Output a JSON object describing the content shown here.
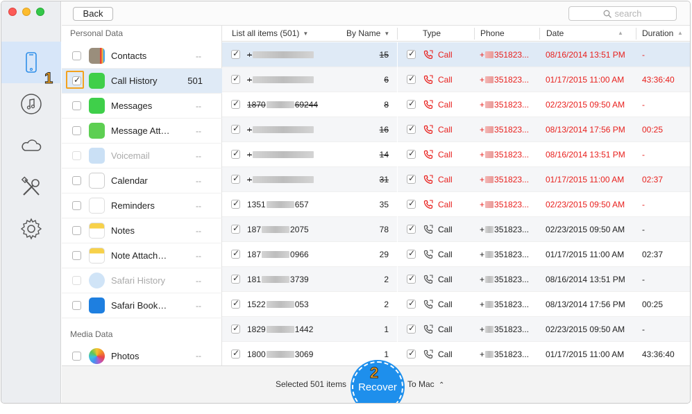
{
  "toolbar": {
    "back_label": "Back",
    "search_placeholder": "search"
  },
  "sidebar": {
    "icons": [
      "phone-icon",
      "music-icon",
      "cloud-icon",
      "tools-icon",
      "gear-icon"
    ]
  },
  "categories": {
    "personal_title": "Personal Data",
    "media_title": "Media Data",
    "items": [
      {
        "label": "Contacts",
        "count": "--",
        "checked": false,
        "disabled": false,
        "icon": "contacts-icon"
      },
      {
        "label": "Call History",
        "count": "501",
        "checked": true,
        "disabled": false,
        "icon": "phone-app-icon"
      },
      {
        "label": "Messages",
        "count": "--",
        "checked": false,
        "disabled": false,
        "icon": "messages-icon"
      },
      {
        "label": "Message Att…",
        "count": "--",
        "checked": false,
        "disabled": false,
        "icon": "message-attachment-icon"
      },
      {
        "label": "Voicemail",
        "count": "--",
        "checked": false,
        "disabled": true,
        "icon": "voicemail-icon"
      },
      {
        "label": "Calendar",
        "count": "--",
        "checked": false,
        "disabled": false,
        "icon": "calendar-icon"
      },
      {
        "label": "Reminders",
        "count": "--",
        "checked": false,
        "disabled": false,
        "icon": "reminders-icon"
      },
      {
        "label": "Notes",
        "count": "--",
        "checked": false,
        "disabled": false,
        "icon": "notes-icon"
      },
      {
        "label": "Note Attach…",
        "count": "--",
        "checked": false,
        "disabled": false,
        "icon": "note-attachment-icon"
      },
      {
        "label": "Safari History",
        "count": "--",
        "checked": false,
        "disabled": true,
        "icon": "safari-icon"
      },
      {
        "label": "Safari Book…",
        "count": "--",
        "checked": false,
        "disabled": false,
        "icon": "bookmark-icon"
      }
    ],
    "media_items": [
      {
        "label": "Photos",
        "count": "--",
        "checked": false,
        "disabled": false,
        "icon": "photos-icon"
      }
    ]
  },
  "list_header": {
    "filter_label": "List all items (501)",
    "sort_label": "By Name"
  },
  "detail_header": {
    "type": "Type",
    "phone": "Phone",
    "date": "Date",
    "duration": "Duration"
  },
  "names": [
    {
      "prefix": "+",
      "suffix": "",
      "count": "15",
      "deleted": true
    },
    {
      "prefix": "+",
      "suffix": "",
      "count": "6",
      "deleted": true
    },
    {
      "prefix": "1870",
      "suffix": "69244",
      "count": "8",
      "deleted": true
    },
    {
      "prefix": "+",
      "suffix": "",
      "count": "16",
      "deleted": true
    },
    {
      "prefix": "+",
      "suffix": "",
      "count": "14",
      "deleted": true
    },
    {
      "prefix": "+",
      "suffix": "",
      "count": "31",
      "deleted": true
    },
    {
      "prefix": "1351",
      "suffix": "657",
      "count": "35",
      "deleted": false
    },
    {
      "prefix": "187",
      "suffix": "2075",
      "count": "78",
      "deleted": false
    },
    {
      "prefix": "187",
      "suffix": "0966",
      "count": "29",
      "deleted": false
    },
    {
      "prefix": "181",
      "suffix": "3739",
      "count": "2",
      "deleted": false
    },
    {
      "prefix": "1522",
      "suffix": "053",
      "count": "2",
      "deleted": false
    },
    {
      "prefix": "1829",
      "suffix": "1442",
      "count": "1",
      "deleted": false
    },
    {
      "prefix": "1800",
      "suffix": "3069",
      "count": "1",
      "deleted": false
    }
  ],
  "calls": [
    {
      "type": "Call",
      "phone_prefix": "+",
      "phone_suffix": "351823...",
      "date": "08/16/2014 13:51 PM",
      "duration": "-",
      "deleted": true
    },
    {
      "type": "Call",
      "phone_prefix": "+",
      "phone_suffix": "351823...",
      "date": "01/17/2015 11:00 AM",
      "duration": "43:36:40",
      "deleted": true
    },
    {
      "type": "Call",
      "phone_prefix": "+",
      "phone_suffix": "351823...",
      "date": "02/23/2015 09:50 AM",
      "duration": "-",
      "deleted": true
    },
    {
      "type": "Call",
      "phone_prefix": "+",
      "phone_suffix": "351823...",
      "date": "08/13/2014 17:56 PM",
      "duration": "00:25",
      "deleted": true
    },
    {
      "type": "Call",
      "phone_prefix": "+",
      "phone_suffix": "351823...",
      "date": "08/16/2014 13:51 PM",
      "duration": "-",
      "deleted": true
    },
    {
      "type": "Call",
      "phone_prefix": "+",
      "phone_suffix": "351823...",
      "date": "01/17/2015 11:00 AM",
      "duration": "02:37",
      "deleted": true
    },
    {
      "type": "Call",
      "phone_prefix": "+",
      "phone_suffix": "351823...",
      "date": "02/23/2015 09:50 AM",
      "duration": "-",
      "deleted": true
    },
    {
      "type": "Call",
      "phone_prefix": "+",
      "phone_suffix": "351823...",
      "date": "02/23/2015 09:50 AM",
      "duration": "-",
      "deleted": false
    },
    {
      "type": "Call",
      "phone_prefix": "+",
      "phone_suffix": "351823...",
      "date": "01/17/2015 11:00 AM",
      "duration": "02:37",
      "deleted": false
    },
    {
      "type": "Call",
      "phone_prefix": "+",
      "phone_suffix": "351823...",
      "date": "08/16/2014 13:51 PM",
      "duration": "-",
      "deleted": false
    },
    {
      "type": "Call",
      "phone_prefix": "+",
      "phone_suffix": "351823...",
      "date": "08/13/2014 17:56 PM",
      "duration": "00:25",
      "deleted": false
    },
    {
      "type": "Call",
      "phone_prefix": "+",
      "phone_suffix": "351823...",
      "date": "02/23/2015 09:50 AM",
      "duration": "-",
      "deleted": false
    },
    {
      "type": "Call",
      "phone_prefix": "+",
      "phone_suffix": "351823...",
      "date": "01/17/2015 11:00 AM",
      "duration": "43:36:40",
      "deleted": false
    }
  ],
  "footer": {
    "selected_text": "Selected 501 items",
    "recover_label": "Recover",
    "destination": "To Mac"
  },
  "annotations": {
    "step1": "1",
    "step2": "2"
  },
  "colors": {
    "deleted_red": "#e8201d",
    "accent_blue": "#1e8fec",
    "highlight_orange": "#f3a21e"
  }
}
